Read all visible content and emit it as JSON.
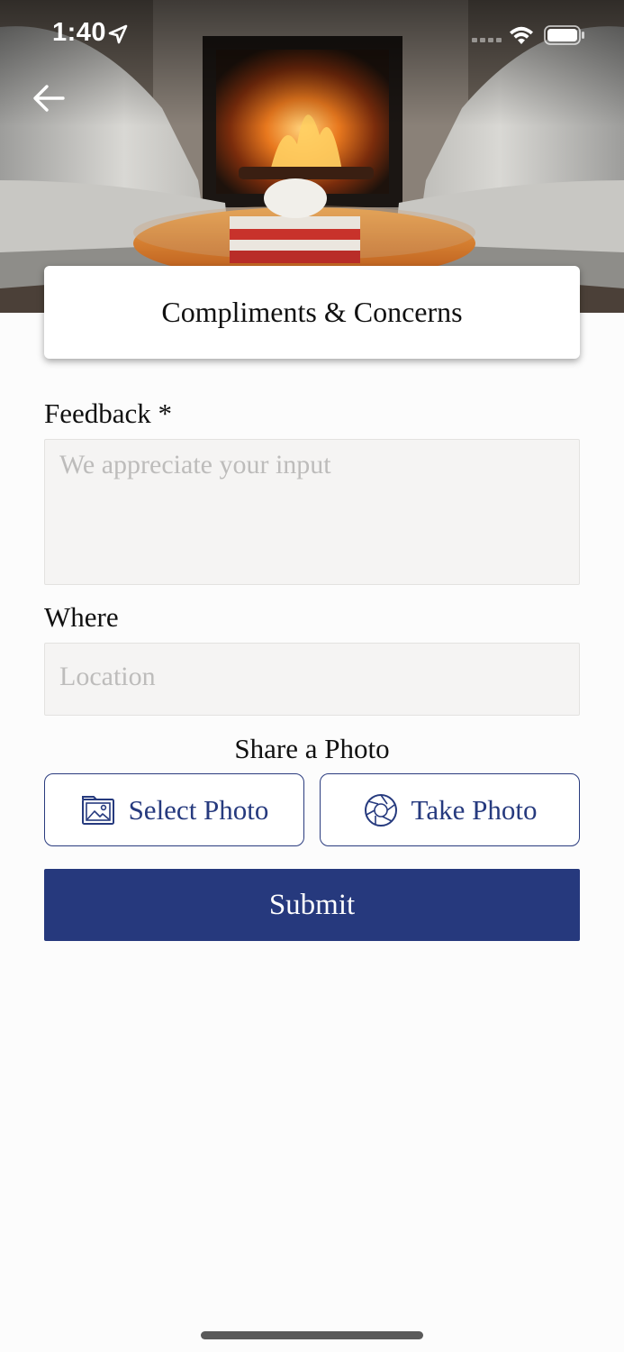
{
  "status_bar": {
    "time": "1:40",
    "location_icon": "location-arrow-icon",
    "signal_icon": "cellular-signal-icon",
    "wifi_icon": "wifi-icon",
    "battery_icon": "battery-icon"
  },
  "header": {
    "back_icon": "arrow-left-icon",
    "title": "Compliments & Concerns"
  },
  "form": {
    "feedback": {
      "label": "Feedback *",
      "placeholder": "We appreciate your input",
      "value": ""
    },
    "where": {
      "label": "Where",
      "placeholder": "Location",
      "value": ""
    },
    "share_photo": {
      "heading": "Share a Photo",
      "select_photo_label": "Select Photo",
      "select_photo_icon": "image-gallery-icon",
      "take_photo_label": "Take Photo",
      "take_photo_icon": "camera-aperture-icon"
    },
    "submit_label": "Submit"
  },
  "colors": {
    "accent": "#26397d",
    "input_background": "#f5f4f3",
    "placeholder": "#bdbcbb"
  }
}
